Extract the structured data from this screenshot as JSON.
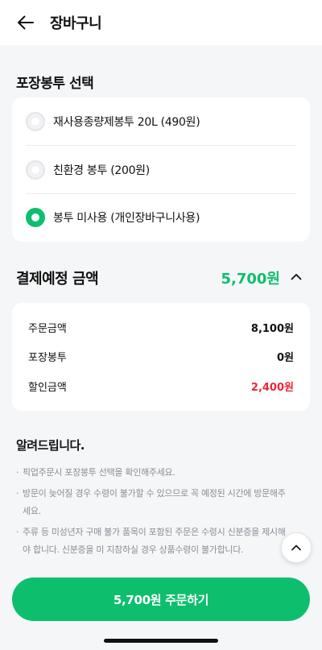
{
  "header": {
    "title": "장바구니",
    "back_icon": "arrow-left-icon"
  },
  "bag_section": {
    "title": "포장봉투 선택",
    "options": [
      {
        "label": "재사용종량제봉투 20L (490원)",
        "selected": false
      },
      {
        "label": "친환경 봉투 (200원)",
        "selected": false
      },
      {
        "label": "봉투 미사용 (개인장바구니사용)",
        "selected": true
      }
    ]
  },
  "payment": {
    "title": "결제예정 금액",
    "total": "5,700원",
    "rows": [
      {
        "label": "주문금액",
        "value": "8,100원"
      },
      {
        "label": "포장봉투",
        "value": "0원"
      },
      {
        "label": "할인금액",
        "value": "2,400원"
      }
    ]
  },
  "notice": {
    "title": "알려드립니다.",
    "items": [
      "픽업주문시 포장봉투 선택을 확인해주세요.",
      "방문이 늦어질 경우 수령이 불가할 수 있으므로 꼭 예정된 시간에 방문해주세요.",
      "주류 등 미성년자 구매 불가 품목이 포함된 주문은 수령시 신분증을 제시해야 합니다. 신분증을 미 지참하실 경우 상품수령이 불가합니다."
    ]
  },
  "order_button": {
    "label": "5,700원 주문하기"
  },
  "colors": {
    "accent": "#0dbf6d",
    "discount": "#e8283b"
  }
}
